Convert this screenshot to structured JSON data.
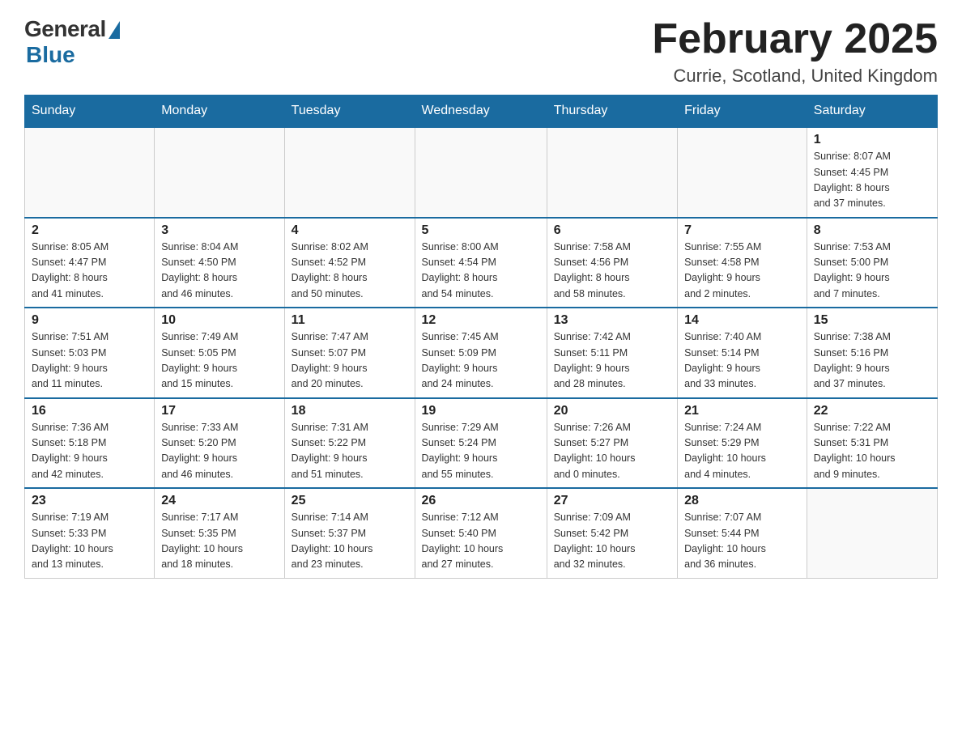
{
  "header": {
    "logo_general": "General",
    "logo_blue": "Blue",
    "month_title": "February 2025",
    "location": "Currie, Scotland, United Kingdom"
  },
  "days_of_week": [
    "Sunday",
    "Monday",
    "Tuesday",
    "Wednesday",
    "Thursday",
    "Friday",
    "Saturday"
  ],
  "weeks": [
    {
      "days": [
        {
          "number": "",
          "info": ""
        },
        {
          "number": "",
          "info": ""
        },
        {
          "number": "",
          "info": ""
        },
        {
          "number": "",
          "info": ""
        },
        {
          "number": "",
          "info": ""
        },
        {
          "number": "",
          "info": ""
        },
        {
          "number": "1",
          "info": "Sunrise: 8:07 AM\nSunset: 4:45 PM\nDaylight: 8 hours\nand 37 minutes."
        }
      ]
    },
    {
      "days": [
        {
          "number": "2",
          "info": "Sunrise: 8:05 AM\nSunset: 4:47 PM\nDaylight: 8 hours\nand 41 minutes."
        },
        {
          "number": "3",
          "info": "Sunrise: 8:04 AM\nSunset: 4:50 PM\nDaylight: 8 hours\nand 46 minutes."
        },
        {
          "number": "4",
          "info": "Sunrise: 8:02 AM\nSunset: 4:52 PM\nDaylight: 8 hours\nand 50 minutes."
        },
        {
          "number": "5",
          "info": "Sunrise: 8:00 AM\nSunset: 4:54 PM\nDaylight: 8 hours\nand 54 minutes."
        },
        {
          "number": "6",
          "info": "Sunrise: 7:58 AM\nSunset: 4:56 PM\nDaylight: 8 hours\nand 58 minutes."
        },
        {
          "number": "7",
          "info": "Sunrise: 7:55 AM\nSunset: 4:58 PM\nDaylight: 9 hours\nand 2 minutes."
        },
        {
          "number": "8",
          "info": "Sunrise: 7:53 AM\nSunset: 5:00 PM\nDaylight: 9 hours\nand 7 minutes."
        }
      ]
    },
    {
      "days": [
        {
          "number": "9",
          "info": "Sunrise: 7:51 AM\nSunset: 5:03 PM\nDaylight: 9 hours\nand 11 minutes."
        },
        {
          "number": "10",
          "info": "Sunrise: 7:49 AM\nSunset: 5:05 PM\nDaylight: 9 hours\nand 15 minutes."
        },
        {
          "number": "11",
          "info": "Sunrise: 7:47 AM\nSunset: 5:07 PM\nDaylight: 9 hours\nand 20 minutes."
        },
        {
          "number": "12",
          "info": "Sunrise: 7:45 AM\nSunset: 5:09 PM\nDaylight: 9 hours\nand 24 minutes."
        },
        {
          "number": "13",
          "info": "Sunrise: 7:42 AM\nSunset: 5:11 PM\nDaylight: 9 hours\nand 28 minutes."
        },
        {
          "number": "14",
          "info": "Sunrise: 7:40 AM\nSunset: 5:14 PM\nDaylight: 9 hours\nand 33 minutes."
        },
        {
          "number": "15",
          "info": "Sunrise: 7:38 AM\nSunset: 5:16 PM\nDaylight: 9 hours\nand 37 minutes."
        }
      ]
    },
    {
      "days": [
        {
          "number": "16",
          "info": "Sunrise: 7:36 AM\nSunset: 5:18 PM\nDaylight: 9 hours\nand 42 minutes."
        },
        {
          "number": "17",
          "info": "Sunrise: 7:33 AM\nSunset: 5:20 PM\nDaylight: 9 hours\nand 46 minutes."
        },
        {
          "number": "18",
          "info": "Sunrise: 7:31 AM\nSunset: 5:22 PM\nDaylight: 9 hours\nand 51 minutes."
        },
        {
          "number": "19",
          "info": "Sunrise: 7:29 AM\nSunset: 5:24 PM\nDaylight: 9 hours\nand 55 minutes."
        },
        {
          "number": "20",
          "info": "Sunrise: 7:26 AM\nSunset: 5:27 PM\nDaylight: 10 hours\nand 0 minutes."
        },
        {
          "number": "21",
          "info": "Sunrise: 7:24 AM\nSunset: 5:29 PM\nDaylight: 10 hours\nand 4 minutes."
        },
        {
          "number": "22",
          "info": "Sunrise: 7:22 AM\nSunset: 5:31 PM\nDaylight: 10 hours\nand 9 minutes."
        }
      ]
    },
    {
      "days": [
        {
          "number": "23",
          "info": "Sunrise: 7:19 AM\nSunset: 5:33 PM\nDaylight: 10 hours\nand 13 minutes."
        },
        {
          "number": "24",
          "info": "Sunrise: 7:17 AM\nSunset: 5:35 PM\nDaylight: 10 hours\nand 18 minutes."
        },
        {
          "number": "25",
          "info": "Sunrise: 7:14 AM\nSunset: 5:37 PM\nDaylight: 10 hours\nand 23 minutes."
        },
        {
          "number": "26",
          "info": "Sunrise: 7:12 AM\nSunset: 5:40 PM\nDaylight: 10 hours\nand 27 minutes."
        },
        {
          "number": "27",
          "info": "Sunrise: 7:09 AM\nSunset: 5:42 PM\nDaylight: 10 hours\nand 32 minutes."
        },
        {
          "number": "28",
          "info": "Sunrise: 7:07 AM\nSunset: 5:44 PM\nDaylight: 10 hours\nand 36 minutes."
        },
        {
          "number": "",
          "info": ""
        }
      ]
    }
  ]
}
